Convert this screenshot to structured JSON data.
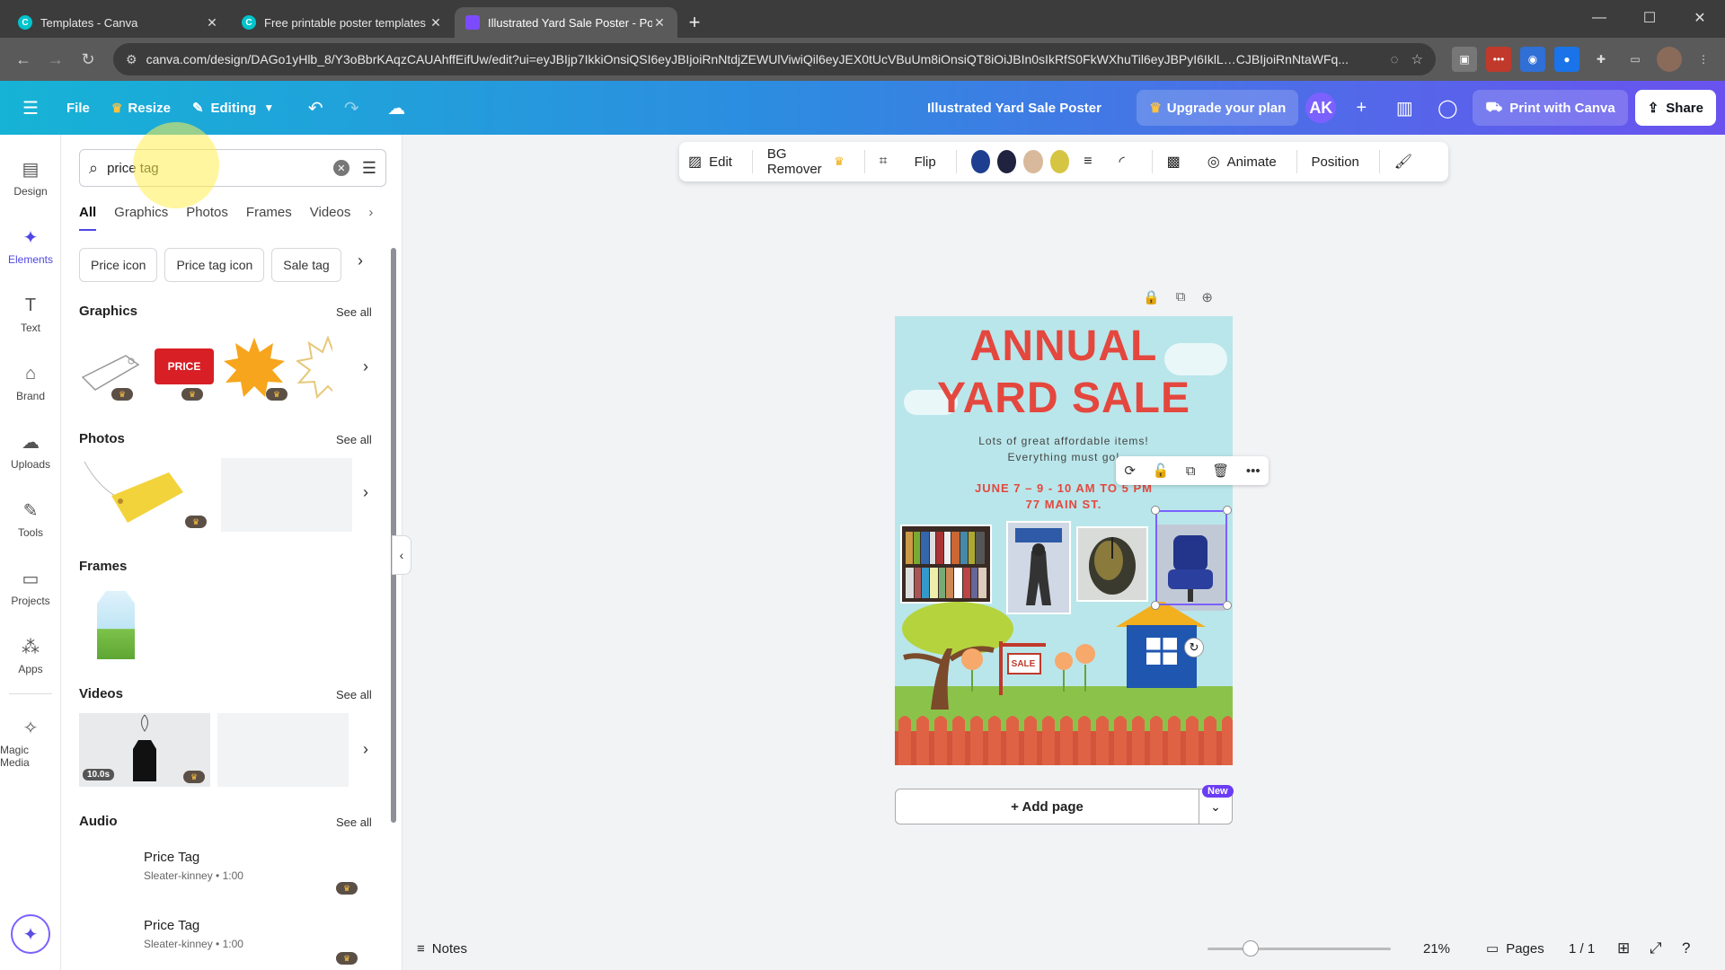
{
  "browser": {
    "tabs": [
      {
        "title": "Templates - Canva",
        "active": false
      },
      {
        "title": "Free printable poster templates",
        "active": false
      },
      {
        "title": "Illustrated Yard Sale Poster - Po",
        "active": true
      }
    ],
    "url": "canva.com/design/DAGo1yHlb_8/Y3oBbrKAqzCAUAhffEifUw/edit?ui=eyJBIjp7IkkiOnsiQSI6eyJBIjoiRnNtdjZEWUlViwiQil6eyJEX0tUcVBuUm8iOnsiQT8iOiJBIn0sIkRfS0FkWXhuTil6eyJBPyI6IklL…CJBIjoiRnNtaWFq..."
  },
  "header": {
    "file": "File",
    "resize": "Resize",
    "editing": "Editing",
    "doc_title": "Illustrated Yard Sale Poster",
    "upgrade": "Upgrade your plan",
    "avatar": "AK",
    "print": "Print with Canva",
    "share": "Share"
  },
  "rail": [
    {
      "label": "Design",
      "icon": "design-icon"
    },
    {
      "label": "Elements",
      "icon": "elements-icon",
      "active": true
    },
    {
      "label": "Text",
      "icon": "text-icon"
    },
    {
      "label": "Brand",
      "icon": "brand-icon"
    },
    {
      "label": "Uploads",
      "icon": "uploads-icon"
    },
    {
      "label": "Tools",
      "icon": "tools-icon"
    },
    {
      "label": "Projects",
      "icon": "projects-icon"
    },
    {
      "label": "Apps",
      "icon": "apps-icon"
    },
    {
      "label": "Magic Media",
      "icon": "magic-media-icon"
    }
  ],
  "panel": {
    "search_value": "price tag",
    "filter_tabs": [
      "All",
      "Graphics",
      "Photos",
      "Frames",
      "Videos"
    ],
    "chips": [
      "Price icon",
      "Price tag icon",
      "Sale tag"
    ],
    "sections": {
      "graphics": "Graphics",
      "photos": "Photos",
      "frames": "Frames",
      "videos": "Videos",
      "audio": "Audio"
    },
    "see_all": "See all",
    "graphic_price_label": "PRICE",
    "video_duration": "10.0s",
    "audio": [
      {
        "title": "Price Tag",
        "sub": "Sleater-kinney • 1:00"
      },
      {
        "title": "Price Tag",
        "sub": "Sleater-kinney • 1:00"
      }
    ]
  },
  "toolbar": {
    "edit": "Edit",
    "bg_remover": "BG Remover",
    "flip": "Flip",
    "animate": "Animate",
    "position": "Position",
    "colors": [
      "#1e3f8f",
      "#1f2340",
      "#d9b99b",
      "#d6c542"
    ]
  },
  "poster": {
    "line1": "ANNUAL",
    "line2": "YARD SALE",
    "sub1": "Lots of great affordable items!",
    "sub2": "Everything must go!",
    "date": "JUNE 7 – 9 - 10 AM TO 5 PM",
    "address": "77 MAIN ST.",
    "sign": "SALE"
  },
  "canvas": {
    "add_page": "+ Add page",
    "new_badge": "New"
  },
  "footer": {
    "notes": "Notes",
    "zoom": "21%",
    "zoom_fraction": 0.21,
    "pages": "Pages",
    "page_count": "1 / 1"
  },
  "colors": {
    "accent": "#4f46e5",
    "poster_bg": "#b9e6ea",
    "poster_red": "#e4473e"
  }
}
